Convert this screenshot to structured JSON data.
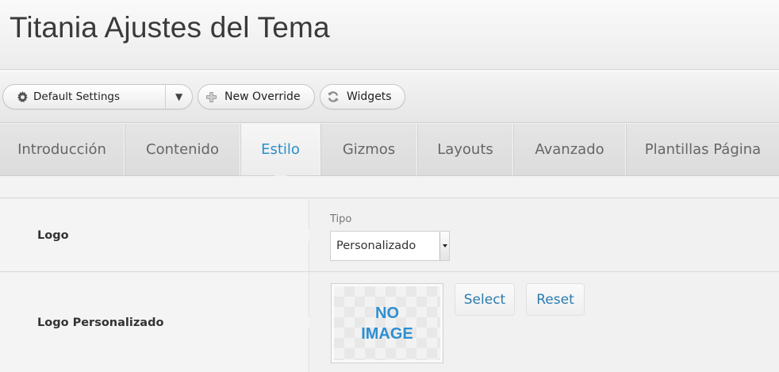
{
  "header": {
    "title": "Titania Ajustes del Tema"
  },
  "toolbar": {
    "settings_dropdown": {
      "label": "Default Settings",
      "icon": "gear-icon",
      "arrow": "▼"
    },
    "new_override": {
      "label": "New Override",
      "icon": "plus-icon"
    },
    "widgets": {
      "label": "Widgets",
      "icon": "refresh-icon"
    }
  },
  "tabs": [
    {
      "label": "Introducción"
    },
    {
      "label": "Contenido"
    },
    {
      "label": "Estilo",
      "active": true
    },
    {
      "label": "Gizmos"
    },
    {
      "label": "Layouts"
    },
    {
      "label": "Avanzado"
    },
    {
      "label": "Plantillas Página"
    }
  ],
  "rows": {
    "logo": {
      "label": "Logo",
      "field_label": "Tipo",
      "selected": "Personalizado"
    },
    "custom_logo": {
      "label": "Logo Personalizado",
      "placeholder_line1": "NO",
      "placeholder_line2": "IMAGE",
      "select_label": "Select",
      "reset_label": "Reset"
    }
  },
  "colors": {
    "accent": "#2a8fc9",
    "link": "#2a7cb0",
    "placeholder_text": "#2e8fd1"
  }
}
